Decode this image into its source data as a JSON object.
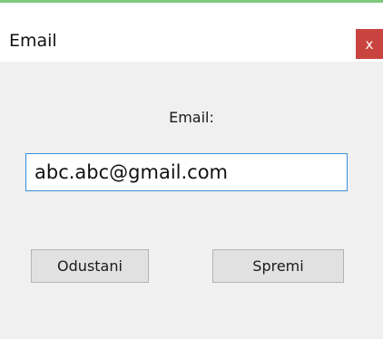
{
  "window": {
    "title": "Email",
    "close_label": "x"
  },
  "form": {
    "email_label": "Email:",
    "email_value": "abc.abc@gmail.com"
  },
  "buttons": {
    "cancel_label": "Odustani",
    "save_label": "Spremi"
  },
  "colors": {
    "accent_top": "#7fc97f",
    "close_button": "#c9433f",
    "input_border": "#3a8fd6",
    "dialog_background": "#f0f0f0"
  },
  "icons": {
    "close": "close-icon"
  }
}
